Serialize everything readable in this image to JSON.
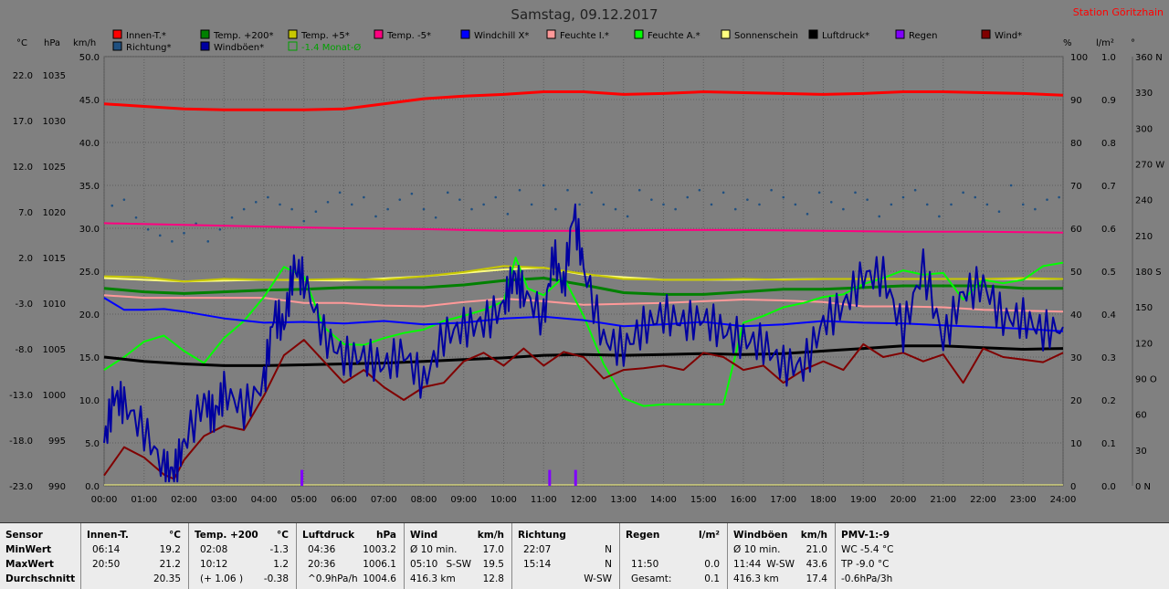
{
  "title": "Samstag, 09.12.2017",
  "station": "Station Göritzhain",
  "legend": [
    {
      "label": "Innen-T.*",
      "color": "#ff0000"
    },
    {
      "label": "Temp. +200*",
      "color": "#008000"
    },
    {
      "label": "Temp. +5*",
      "color": "#c8c800"
    },
    {
      "label": "Temp. -5*",
      "color": "#ff0080"
    },
    {
      "label": "Windchill X*",
      "color": "#0000ff"
    },
    {
      "label": "Feuchte I.*",
      "color": "#ff9999"
    },
    {
      "label": "Feuchte A.*",
      "color": "#00ff00"
    },
    {
      "label": "Sonnenschein",
      "color": "#ffff80"
    },
    {
      "label": "Luftdruck*",
      "color": "#000000"
    },
    {
      "label": "Regen",
      "color": "#8000ff"
    },
    {
      "label": "Wind*",
      "color": "#800000"
    },
    {
      "label": "Richtung*",
      "color": "#205080"
    },
    {
      "label": "Windböen*",
      "color": "#0000a0"
    },
    {
      "label": "-1.4 Monat-Ø",
      "color": "#00a000",
      "open": true
    }
  ],
  "axis_units": {
    "celsius": "°C",
    "hpa": "hPa",
    "kmh": "km/h",
    "pct": "%",
    "lm2": "l/m²",
    "deg": "°"
  },
  "chart_data": {
    "type": "line",
    "x_ticks": [
      "00:00",
      "01:00",
      "02:00",
      "03:00",
      "04:00",
      "05:00",
      "06:00",
      "07:00",
      "08:00",
      "09:00",
      "10:00",
      "11:00",
      "12:00",
      "13:00",
      "14:00",
      "15:00",
      "16:00",
      "17:00",
      "18:00",
      "19:00",
      "20:00",
      "21:00",
      "22:00",
      "23:00",
      "24:00"
    ],
    "left_kmh": {
      "ticks": [
        "0.0",
        "5.0",
        "10.0",
        "15.0",
        "20.0",
        "25.0",
        "30.0",
        "35.0",
        "40.0",
        "45.0",
        "50.0"
      ],
      "range": [
        0,
        50
      ]
    },
    "left_celsius": {
      "ticks": [
        "-23.0",
        "-18.0",
        "-13.0",
        "-8.0",
        "-3.0",
        "2.0",
        "7.0",
        "12.0",
        "17.0",
        "22.0"
      ],
      "range": [
        -23,
        24
      ]
    },
    "left_hpa": {
      "ticks": [
        "990",
        "995",
        "1000",
        "1005",
        "1010",
        "1015",
        "1020",
        "1025",
        "1030",
        "1035"
      ],
      "range": [
        990,
        1037
      ]
    },
    "right_pct": {
      "ticks": [
        "0",
        "10",
        "20",
        "30",
        "40",
        "50",
        "60",
        "70",
        "80",
        "90",
        "100"
      ],
      "range": [
        0,
        100
      ]
    },
    "right_lm2": {
      "ticks": [
        "0.0",
        "0.1",
        "0.2",
        "0.3",
        "0.4",
        "0.5",
        "0.6",
        "0.7",
        "0.8",
        "0.9",
        "1.0"
      ],
      "range": [
        0,
        1
      ]
    },
    "right_deg": {
      "ticks": [
        "0 N",
        "30",
        "60",
        "90 O",
        "120",
        "150",
        "180 S",
        "210",
        "240",
        "270 W",
        "300",
        "330",
        "360 N"
      ],
      "range": [
        0,
        360
      ]
    },
    "y_units": "km/h (left scale)",
    "series": [
      {
        "name": "Innen-T.*",
        "color": "#ff0000",
        "width": 3,
        "x": [
          0,
          1,
          2,
          3,
          4,
          5,
          6,
          7,
          8,
          9,
          10,
          11,
          12,
          13,
          14,
          15,
          16,
          17,
          18,
          19,
          20,
          21,
          22,
          23,
          24
        ],
        "y": [
          44.5,
          44.2,
          43.9,
          43.8,
          43.8,
          43.8,
          43.9,
          44.5,
          45.1,
          45.4,
          45.6,
          45.9,
          45.9,
          45.6,
          45.7,
          45.9,
          45.8,
          45.7,
          45.6,
          45.7,
          45.9,
          45.9,
          45.8,
          45.7,
          45.5
        ]
      },
      {
        "name": "Temp. -5*",
        "color": "#ff0080",
        "width": 2,
        "x": [
          0,
          2,
          4,
          6,
          8,
          10,
          12,
          14,
          16,
          18,
          20,
          22,
          24
        ],
        "y": [
          30.6,
          30.4,
          30.2,
          30.0,
          29.9,
          29.7,
          29.7,
          29.8,
          29.8,
          29.7,
          29.6,
          29.6,
          29.5
        ]
      },
      {
        "name": "Sonnenschein",
        "color": "#ffff80",
        "width": 2,
        "x": [
          0,
          2,
          4,
          6,
          8,
          10,
          11,
          12,
          14,
          16,
          18,
          20,
          22,
          24
        ],
        "y": [
          24.2,
          23.8,
          24.0,
          23.9,
          24.4,
          25.2,
          25.4,
          24.6,
          24.0,
          24.0,
          24.1,
          24.1,
          24.1,
          24.1
        ]
      },
      {
        "name": "Temp. +5*",
        "color": "#c8c800",
        "width": 2,
        "x": [
          0,
          1,
          2,
          3,
          4,
          5,
          6,
          7,
          8,
          9,
          10,
          11,
          12,
          13,
          14,
          15,
          16,
          17,
          18,
          19,
          20,
          21,
          22,
          23,
          24
        ],
        "y": [
          24.4,
          24.3,
          23.8,
          24.1,
          24.0,
          24.0,
          24.1,
          24.0,
          24.4,
          24.9,
          25.6,
          25.4,
          24.7,
          24.1,
          24.0,
          24.0,
          24.1,
          24.0,
          24.1,
          24.1,
          24.1,
          24.1,
          24.1,
          24.2,
          24.1
        ]
      },
      {
        "name": "Temp. +200*",
        "color": "#008000",
        "width": 3,
        "x": [
          0,
          1,
          2,
          3,
          4,
          5,
          6,
          7,
          8,
          9,
          10,
          11,
          12,
          13,
          14,
          15,
          16,
          17,
          18,
          19,
          20,
          21,
          22,
          23,
          24
        ],
        "y": [
          23.0,
          22.6,
          22.4,
          22.6,
          22.8,
          22.9,
          23.1,
          23.1,
          23.1,
          23.4,
          23.9,
          24.2,
          23.4,
          22.5,
          22.3,
          22.3,
          22.6,
          22.9,
          22.9,
          23.1,
          23.3,
          23.3,
          23.3,
          23.0,
          23.0
        ]
      },
      {
        "name": "Feuchte I.*",
        "color": "#ff9999",
        "width": 2,
        "x": [
          0,
          1,
          2,
          3,
          4,
          5,
          6,
          7,
          8,
          9,
          10,
          11,
          12,
          13,
          14,
          15,
          16,
          17,
          18,
          19,
          20,
          21,
          22,
          23,
          24
        ],
        "y": [
          22.2,
          21.9,
          21.9,
          21.9,
          21.9,
          21.3,
          21.3,
          21.0,
          20.9,
          21.4,
          21.8,
          21.5,
          21.1,
          21.2,
          21.3,
          21.5,
          21.7,
          21.6,
          21.4,
          20.9,
          20.9,
          20.8,
          20.5,
          20.4,
          20.3
        ]
      },
      {
        "name": "Feuchte A.*",
        "color": "#00ff00",
        "width": 2,
        "x": [
          0,
          0.5,
          1,
          1.5,
          2,
          2.5,
          3,
          3.5,
          4,
          4.5,
          5,
          5.5,
          6,
          6.5,
          7,
          7.5,
          8,
          8.5,
          9,
          9.5,
          10,
          10.3,
          10.6,
          11,
          11.5,
          12,
          12.5,
          13,
          13.5,
          14,
          15,
          15.5,
          16,
          16.5,
          17,
          17.5,
          18,
          18.5,
          19,
          19.5,
          20,
          20.5,
          21,
          21.5,
          22,
          22.5,
          23,
          23.5,
          24
        ],
        "y": [
          13.5,
          15,
          16.8,
          17.5,
          15.7,
          14.3,
          17.2,
          19.2,
          22,
          25.5,
          24.4,
          18.5,
          16.5,
          16.4,
          17.2,
          17.8,
          18.2,
          19.2,
          19.8,
          20.5,
          21.5,
          26.6,
          23,
          22.2,
          24.3,
          19.8,
          14.2,
          10.2,
          9.3,
          9.5,
          9.5,
          9.5,
          19.0,
          19.8,
          20.8,
          21.3,
          22.0,
          22.3,
          23.5,
          24.2,
          25.1,
          24.6,
          24.8,
          21.7,
          24.0,
          23.6,
          24.0,
          25.6,
          26.0
        ]
      },
      {
        "name": "Windchill X*",
        "color": "#0000ff",
        "width": 2,
        "x": [
          0,
          0.5,
          1,
          1.5,
          2,
          3,
          4,
          5,
          6,
          7,
          8,
          9,
          10,
          11,
          12,
          13,
          14,
          15,
          16,
          17,
          18,
          19,
          20,
          21,
          22,
          23,
          24
        ],
        "y": [
          21.9,
          20.5,
          20.5,
          20.6,
          20.3,
          19.5,
          19.0,
          19.1,
          18.9,
          19.2,
          18.8,
          19.0,
          19.5,
          19.7,
          19.3,
          18.6,
          18.8,
          19.1,
          18.6,
          18.8,
          19.2,
          19.0,
          18.9,
          18.7,
          18.5,
          18.3,
          18.0
        ]
      },
      {
        "name": "Luftdruck*",
        "color": "#000000",
        "width": 3,
        "x": [
          0,
          1,
          2,
          3,
          4,
          5,
          6,
          7,
          8,
          9,
          10,
          11,
          12,
          13,
          14,
          15,
          16,
          17,
          18,
          19,
          20,
          21,
          22,
          23,
          24
        ],
        "y": [
          15.0,
          14.5,
          14.2,
          14.0,
          14.0,
          14.1,
          14.2,
          14.3,
          14.5,
          14.7,
          14.9,
          15.2,
          15.3,
          15.2,
          15.3,
          15.4,
          15.3,
          15.4,
          15.7,
          16.0,
          16.3,
          16.3,
          16.1,
          15.9,
          16.0
        ]
      },
      {
        "name": "Wind*",
        "color": "#800000",
        "width": 2,
        "x": [
          0,
          0.5,
          1,
          1.5,
          1.75,
          2,
          2.5,
          3,
          3.5,
          4,
          4.5,
          5,
          5.5,
          6,
          6.5,
          7,
          7.5,
          8,
          8.5,
          9,
          9.5,
          10,
          10.5,
          11,
          11.5,
          12,
          12.5,
          13,
          13.5,
          14,
          14.5,
          15,
          15.5,
          16,
          16.5,
          17,
          17.5,
          18,
          18.5,
          19,
          19.5,
          20,
          20.5,
          21,
          21.5,
          22,
          22.5,
          23,
          23.5,
          24
        ],
        "y": [
          1.2,
          4.5,
          3.3,
          1.3,
          0.8,
          3.0,
          5.8,
          7.0,
          6.5,
          10.5,
          15.2,
          17.0,
          14.5,
          12.0,
          13.5,
          11.5,
          10.0,
          11.5,
          12.0,
          14.5,
          15.5,
          14.0,
          16.0,
          14.0,
          15.6,
          15.0,
          12.5,
          13.5,
          13.7,
          14.0,
          13.5,
          15.5,
          15.0,
          13.5,
          14.0,
          12.0,
          13.5,
          14.5,
          13.5,
          16.5,
          15.0,
          15.5,
          14.5,
          15.3,
          12.0,
          16.0,
          15.0,
          14.7,
          14.4,
          15.5
        ]
      },
      {
        "name": "Windböen*",
        "color": "#0000a0",
        "width": 2,
        "noisy": true,
        "x": [
          0,
          0.25,
          0.5,
          1,
          1.5,
          1.75,
          2,
          2.5,
          2.75,
          3,
          3.5,
          4,
          4.25,
          4.5,
          4.75,
          5,
          5.5,
          6,
          6.5,
          7,
          7.5,
          8,
          8.5,
          9,
          9.5,
          10,
          10.25,
          10.5,
          11,
          11.25,
          11.5,
          11.75,
          12,
          12.5,
          13,
          13.5,
          14,
          14.5,
          15,
          15.5,
          16,
          16.5,
          17,
          17.5,
          18,
          18.5,
          19,
          19.5,
          20,
          20.5,
          21,
          21.5,
          22,
          22.5,
          23,
          23.5,
          24
        ],
        "y": [
          5.0,
          10.5,
          9.5,
          6.5,
          2.0,
          1.5,
          5.0,
          10.0,
          8.0,
          11.0,
          9.0,
          12.0,
          20.0,
          18.5,
          25.5,
          24.0,
          17.5,
          15.0,
          15.0,
          14.0,
          15.5,
          12.0,
          17.5,
          18.5,
          19.0,
          21.0,
          24.5,
          22.5,
          19.5,
          27.0,
          23.0,
          32.0,
          25.5,
          17.0,
          16.0,
          18.5,
          20.0,
          19.0,
          19.5,
          18.0,
          17.0,
          16.5,
          14.0,
          14.0,
          19.0,
          21.0,
          24.5,
          24.5,
          18.0,
          25.5,
          17.0,
          22.5,
          23.5,
          19.5,
          19.5,
          18.0,
          18.5
        ]
      }
    ],
    "richtung_scatter": {
      "name": "Richtung*",
      "color": "#205080",
      "unit": "°",
      "x": [
        0.2,
        0.5,
        0.8,
        1.1,
        1.4,
        1.7,
        2.0,
        2.3,
        2.6,
        2.9,
        3.2,
        3.5,
        3.8,
        4.1,
        4.4,
        4.7,
        5.0,
        5.3,
        5.6,
        5.9,
        6.2,
        6.5,
        6.8,
        7.1,
        7.4,
        7.7,
        8.0,
        8.3,
        8.6,
        8.9,
        9.2,
        9.5,
        9.8,
        10.1,
        10.4,
        10.7,
        11.0,
        11.3,
        11.6,
        11.9,
        12.2,
        12.5,
        12.8,
        13.1,
        13.4,
        13.7,
        14.0,
        14.3,
        14.6,
        14.9,
        15.2,
        15.5,
        15.8,
        16.1,
        16.4,
        16.7,
        17.0,
        17.3,
        17.6,
        17.9,
        18.2,
        18.5,
        18.8,
        19.1,
        19.4,
        19.7,
        20.0,
        20.3,
        20.6,
        20.9,
        21.2,
        21.5,
        21.8,
        22.1,
        22.4,
        22.7,
        23.0,
        23.3,
        23.6,
        23.9
      ],
      "y": [
        235,
        240,
        225,
        215,
        210,
        205,
        212,
        220,
        205,
        215,
        225,
        232,
        238,
        242,
        236,
        232,
        222,
        230,
        238,
        246,
        236,
        242,
        226,
        232,
        240,
        245,
        232,
        225,
        246,
        240,
        232,
        236,
        242,
        228,
        248,
        236,
        252,
        232,
        248,
        236,
        246,
        236,
        232,
        226,
        248,
        240,
        236,
        232,
        242,
        248,
        236,
        246,
        232,
        240,
        236,
        248,
        242,
        236,
        228,
        246,
        238,
        232,
        246,
        240,
        226,
        236,
        242,
        248,
        236,
        226,
        236,
        246,
        242,
        236,
        230,
        252,
        236,
        232,
        240,
        242
      ]
    },
    "regen_marks": {
      "name": "Regen",
      "color": "#8000ff",
      "unit": "l/m²",
      "x": [
        4.95,
        11.15,
        11.8
      ],
      "y": [
        0.02,
        0.02,
        0.02
      ]
    }
  },
  "summary": {
    "sensor": {
      "title": "Sensor",
      "rows": [
        "MinWert",
        "MaxWert",
        "Durchschnitt"
      ]
    },
    "innen": {
      "title": "Innen-T.",
      "unit": "°C",
      "rows": [
        [
          "06:14",
          "19.2"
        ],
        [
          "20:50",
          "21.2"
        ],
        [
          "",
          "20.35"
        ]
      ]
    },
    "temp": {
      "title": "Temp. +200",
      "unit": "°C",
      "rows": [
        [
          "02:08",
          "-1.3"
        ],
        [
          "10:12",
          "1.2"
        ],
        [
          "(+ 1.06 )",
          "-0.38"
        ]
      ]
    },
    "luft": {
      "title": "Luftdruck",
      "unit": "hPa",
      "rows": [
        [
          "04:36",
          "1003.2"
        ],
        [
          "20:36",
          "1006.1"
        ],
        [
          "^0.9hPa/h",
          "1004.6"
        ]
      ]
    },
    "wind": {
      "title": "Wind",
      "unit": "km/h",
      "rows": [
        [
          "Ø 10 min.",
          "",
          "17.0"
        ],
        [
          "05:10",
          "S-SW",
          "19.5"
        ],
        [
          "416.3 km",
          "",
          "12.8"
        ]
      ]
    },
    "richtung": {
      "title": "Richtung",
      "rows": [
        [
          "22:07",
          "N"
        ],
        [
          "15:14",
          "N"
        ],
        [
          "",
          "W-SW"
        ]
      ]
    },
    "regen": {
      "title": "Regen",
      "unit": "l/m²",
      "rows": [
        [
          "",
          ""
        ],
        [
          "11:50",
          "0.0"
        ],
        [
          "Gesamt:",
          "0.1"
        ]
      ]
    },
    "boeen": {
      "title": "Windböen",
      "unit": "km/h",
      "rows": [
        [
          "Ø 10 min.",
          "",
          "21.0"
        ],
        [
          "11:44",
          "W-SW",
          "43.6"
        ],
        [
          "416.3 km",
          "",
          "17.4"
        ]
      ]
    },
    "pmv": {
      "title": "PMV-1:-9",
      "rows": [
        "WC -5.4 °C",
        "TP -9.0 °C",
        "-0.6hPa/3h"
      ]
    }
  }
}
